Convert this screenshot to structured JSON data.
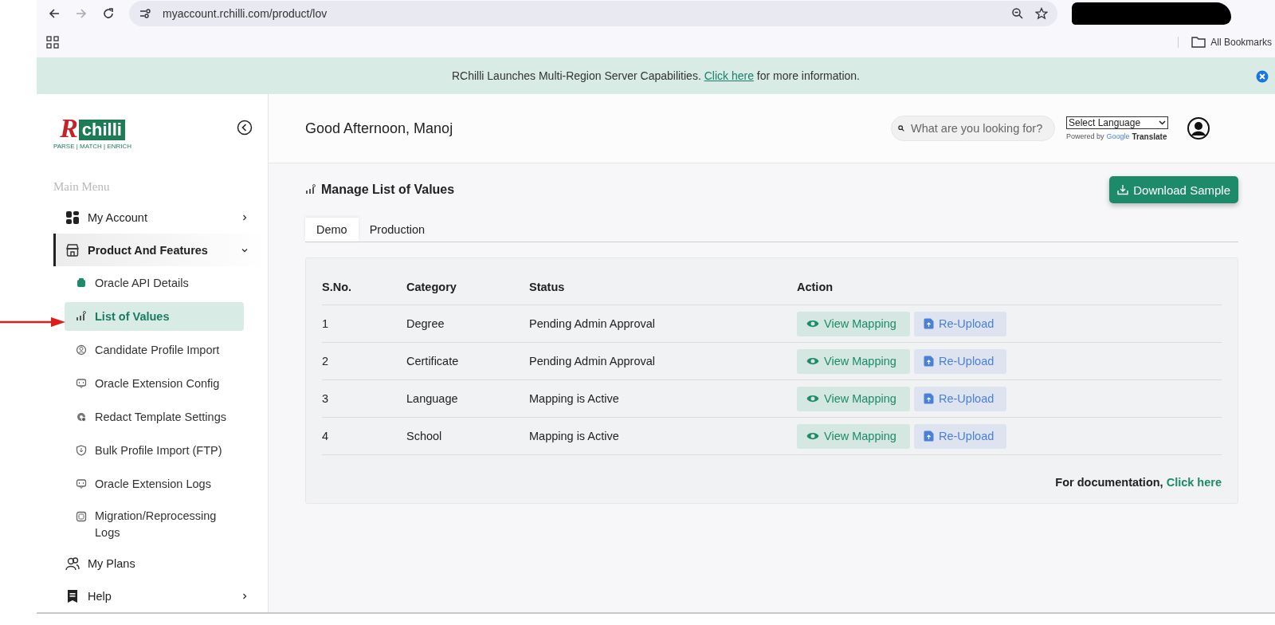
{
  "browser": {
    "url": "myaccount.rchilli.com/product/lov",
    "bookmarks": "All Bookmarks"
  },
  "banner": {
    "text_before": "RChilli Launches Multi-Region Server Capabilities.",
    "link": "Click here",
    "text_after": "for more information."
  },
  "sidebar": {
    "logo": {
      "initial": "R",
      "name": "chilli",
      "tagline": "PARSE | MATCH | ENRICH"
    },
    "section": "Main Menu",
    "items": [
      {
        "label": "My Account",
        "kind": "group",
        "selected": false,
        "expanded": false
      },
      {
        "label": "Product And Features",
        "kind": "group",
        "selected": true,
        "expanded": true,
        "children": [
          {
            "label": "Oracle API Details",
            "selected": false
          },
          {
            "label": "List of Values",
            "selected": true
          },
          {
            "label": "Candidate Profile Import",
            "selected": false
          },
          {
            "label": "Oracle Extension Config",
            "selected": false
          },
          {
            "label": "Redact Template Settings",
            "selected": false
          },
          {
            "label": "Bulk Profile Import (FTP)",
            "selected": false
          },
          {
            "label": "Oracle Extension Logs",
            "selected": false
          },
          {
            "label": "Migration/Reprocessing Logs",
            "selected": false
          }
        ]
      },
      {
        "label": "My Plans",
        "kind": "link",
        "selected": false
      },
      {
        "label": "Help",
        "kind": "group",
        "selected": false,
        "expanded": false
      }
    ]
  },
  "header": {
    "greeting": "Good Afternoon, Manoj",
    "search": {
      "placeholder": "What are you looking for?"
    },
    "language": {
      "value": "Select Language",
      "powered_by": "Powered by",
      "google": "Google",
      "translate": "Translate"
    }
  },
  "page": {
    "title": "Manage List of Values",
    "download_button": "Download Sample",
    "tabs": [
      {
        "label": "Demo",
        "selected": true
      },
      {
        "label": "Production",
        "selected": false
      }
    ],
    "table": {
      "columns": [
        "S.No.",
        "Category",
        "Status",
        "Action"
      ],
      "rows": [
        {
          "sno": "1",
          "category": "Degree",
          "status": "Pending Admin Approval",
          "actions": [
            "View Mapping",
            "Re-Upload"
          ]
        },
        {
          "sno": "2",
          "category": "Certificate",
          "status": "Pending Admin Approval",
          "actions": [
            "View Mapping",
            "Re-Upload"
          ]
        },
        {
          "sno": "3",
          "category": "Language",
          "status": "Mapping is Active",
          "actions": [
            "View Mapping",
            "Re-Upload"
          ]
        },
        {
          "sno": "4",
          "category": "School",
          "status": "Mapping is Active",
          "actions": [
            "View Mapping",
            "Re-Upload"
          ]
        }
      ]
    },
    "documentation": {
      "text": "For documentation,",
      "link": "Click here"
    }
  }
}
